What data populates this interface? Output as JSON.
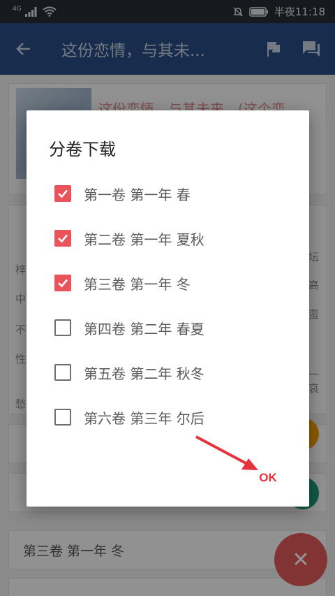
{
  "status_bar": {
    "network": "4G",
    "time": "半夜11:18"
  },
  "app_bar": {
    "title": "这份恋情，与其未...",
    "icons": [
      "back-arrow-icon",
      "flag-icon",
      "comment-icon"
    ]
  },
  "background": {
    "book_title": "这份恋情，与其未来，(这个恋",
    "side_chars_left": [
      "梓",
      "中",
      "不",
      "性",
      "愁"
    ],
    "side_chars_right": [
      "坛",
      "高",
      "蛮",
      "一",
      "哀"
    ],
    "chapter_row_3": "第三卷 第一年 冬",
    "fab_icon": "close-icon",
    "colors": {
      "fab": "#e05a5a",
      "fab_orange": "#f0a000",
      "fab_green": "#1e9a78",
      "app_bar": "#2a4f86"
    }
  },
  "dialog": {
    "title": "分卷下载",
    "options": [
      {
        "label": "第一卷 第一年 春",
        "checked": true
      },
      {
        "label": "第二卷 第一年 夏秋",
        "checked": true
      },
      {
        "label": "第三卷 第一年 冬",
        "checked": true
      },
      {
        "label": "第四卷 第二年 春夏",
        "checked": false
      },
      {
        "label": "第五卷 第二年 秋冬",
        "checked": false
      },
      {
        "label": "第六卷 第三年 尔后",
        "checked": false
      }
    ],
    "ok_label": "OK",
    "colors": {
      "check_accent": "#e8545a",
      "ok": "#e5333c",
      "annotation_arrow": "#e5333c"
    }
  }
}
